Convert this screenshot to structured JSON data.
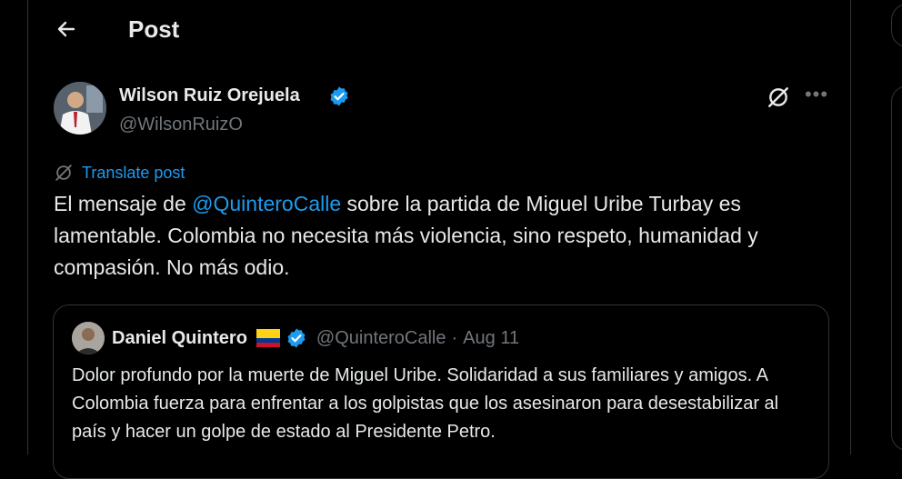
{
  "header": {
    "title": "Post"
  },
  "post": {
    "author_name": "Wilson Ruiz Orejuela",
    "author_handle": "@WilsonRuizO",
    "translate_label": "Translate post",
    "text_before": "El mensaje de ",
    "mention": "@QuinteroCalle",
    "text_after": " sobre la partida de Miguel Uribe Turbay es lamentable. Colombia no necesita más violencia, sino respeto, humanidad y compasión. No más odio."
  },
  "quote": {
    "author_name": "Daniel Quintero",
    "author_handle": "@QuinteroCalle",
    "separator": "·",
    "date": "Aug 11",
    "text": "Dolor profundo por la muerte de Miguel Uribe. Solidaridad a sus familiares y amigos. A Colombia fuerza para enfrentar a los golpistas que los asesinaron para desestabilizar al país y hacer un golpe de estado al Presidente Petro."
  },
  "icons": {
    "back": "arrow-left-icon",
    "verified": "verified-badge-icon",
    "grok": "grok-icon",
    "more": "more-horizontal-icon",
    "translate": "translate-icon",
    "flag": "colombia-flag-icon"
  },
  "colors": {
    "background": "#000000",
    "text": "#e7e9ea",
    "muted": "#71767b",
    "accent": "#1d9bf0",
    "border": "#2f3336"
  }
}
